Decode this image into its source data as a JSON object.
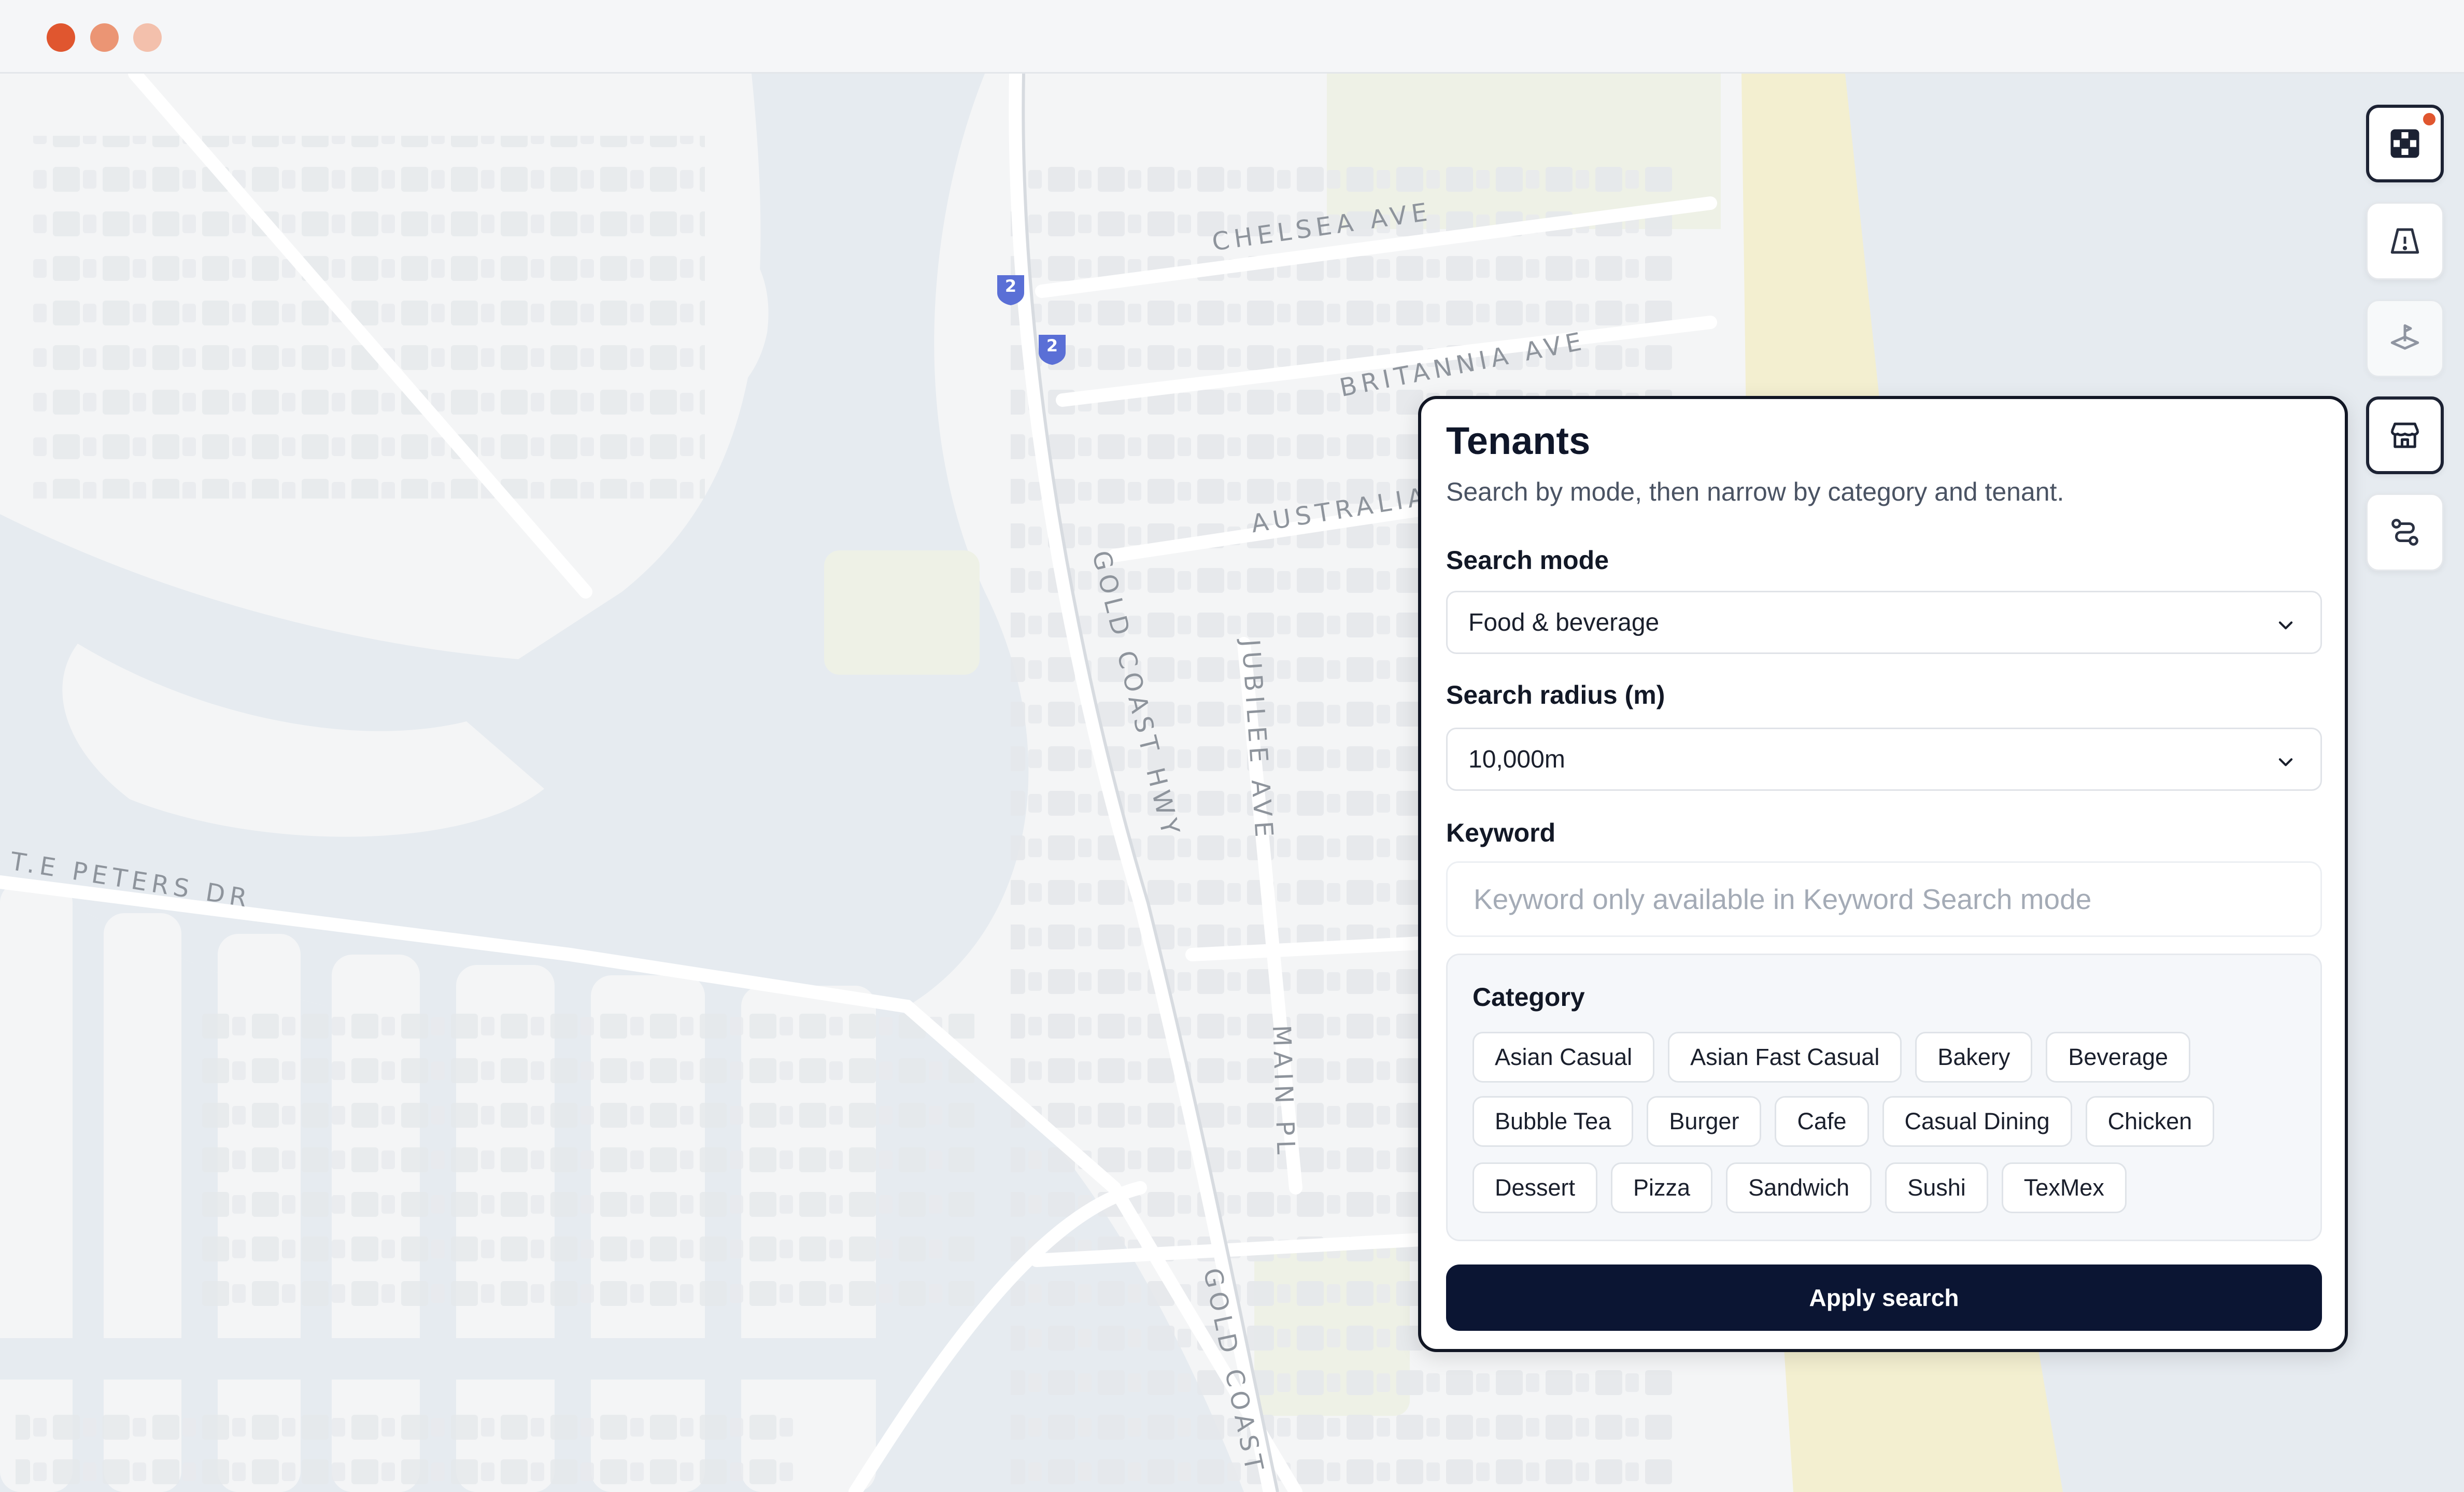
{
  "window": {
    "controls": [
      "close",
      "minimize",
      "maximize"
    ]
  },
  "map": {
    "street_labels": {
      "chelsea": "CHELSEA AVE",
      "britannia": "BRITANNIA AVE",
      "australia": "AUSTRALIA",
      "gold_coast_hwy": "GOLD COAST HWY",
      "jubilee": "JUBILEE AVE",
      "te_peters": "T.E PETERS DR",
      "main_pl": "MAIN PL",
      "gold_coast_lower": "GOLD COAST"
    },
    "route_shields": [
      "2",
      "2"
    ],
    "colors": {
      "water": "#e6ebf0",
      "land": "#f4f5f6",
      "buildings": "#e7e9ec",
      "roads": "#ffffff",
      "beach": "#f3efd0",
      "park": "#eef1e6",
      "shield": "#5a6fd6"
    }
  },
  "rail": {
    "tools": [
      {
        "icon": "grid-icon",
        "active": true,
        "notification": true
      },
      {
        "icon": "road-warning-icon",
        "active": false
      },
      {
        "icon": "map-pin-layers-icon",
        "active": false
      },
      {
        "icon": "storefront-icon",
        "active": true
      },
      {
        "icon": "route-icon",
        "active": false
      }
    ]
  },
  "panel": {
    "title": "Tenants",
    "subtitle": "Search by mode, then narrow by category and tenant.",
    "search_mode": {
      "label": "Search mode",
      "value": "Food & beverage"
    },
    "search_radius": {
      "label": "Search radius (m)",
      "value": "10,000m"
    },
    "keyword": {
      "label": "Keyword",
      "placeholder": "Keyword only available in Keyword Search mode"
    },
    "category": {
      "label": "Category",
      "rows": [
        [
          "Asian Casual",
          "Asian Fast Casual",
          "Bakery",
          "Beverage"
        ],
        [
          "Bubble Tea",
          "Burger",
          "Cafe",
          "Casual Dining",
          "Chicken"
        ],
        [
          "Dessert",
          "Pizza",
          "Sandwich",
          "Sushi",
          "TexMex"
        ]
      ]
    },
    "apply_label": "Apply search"
  }
}
